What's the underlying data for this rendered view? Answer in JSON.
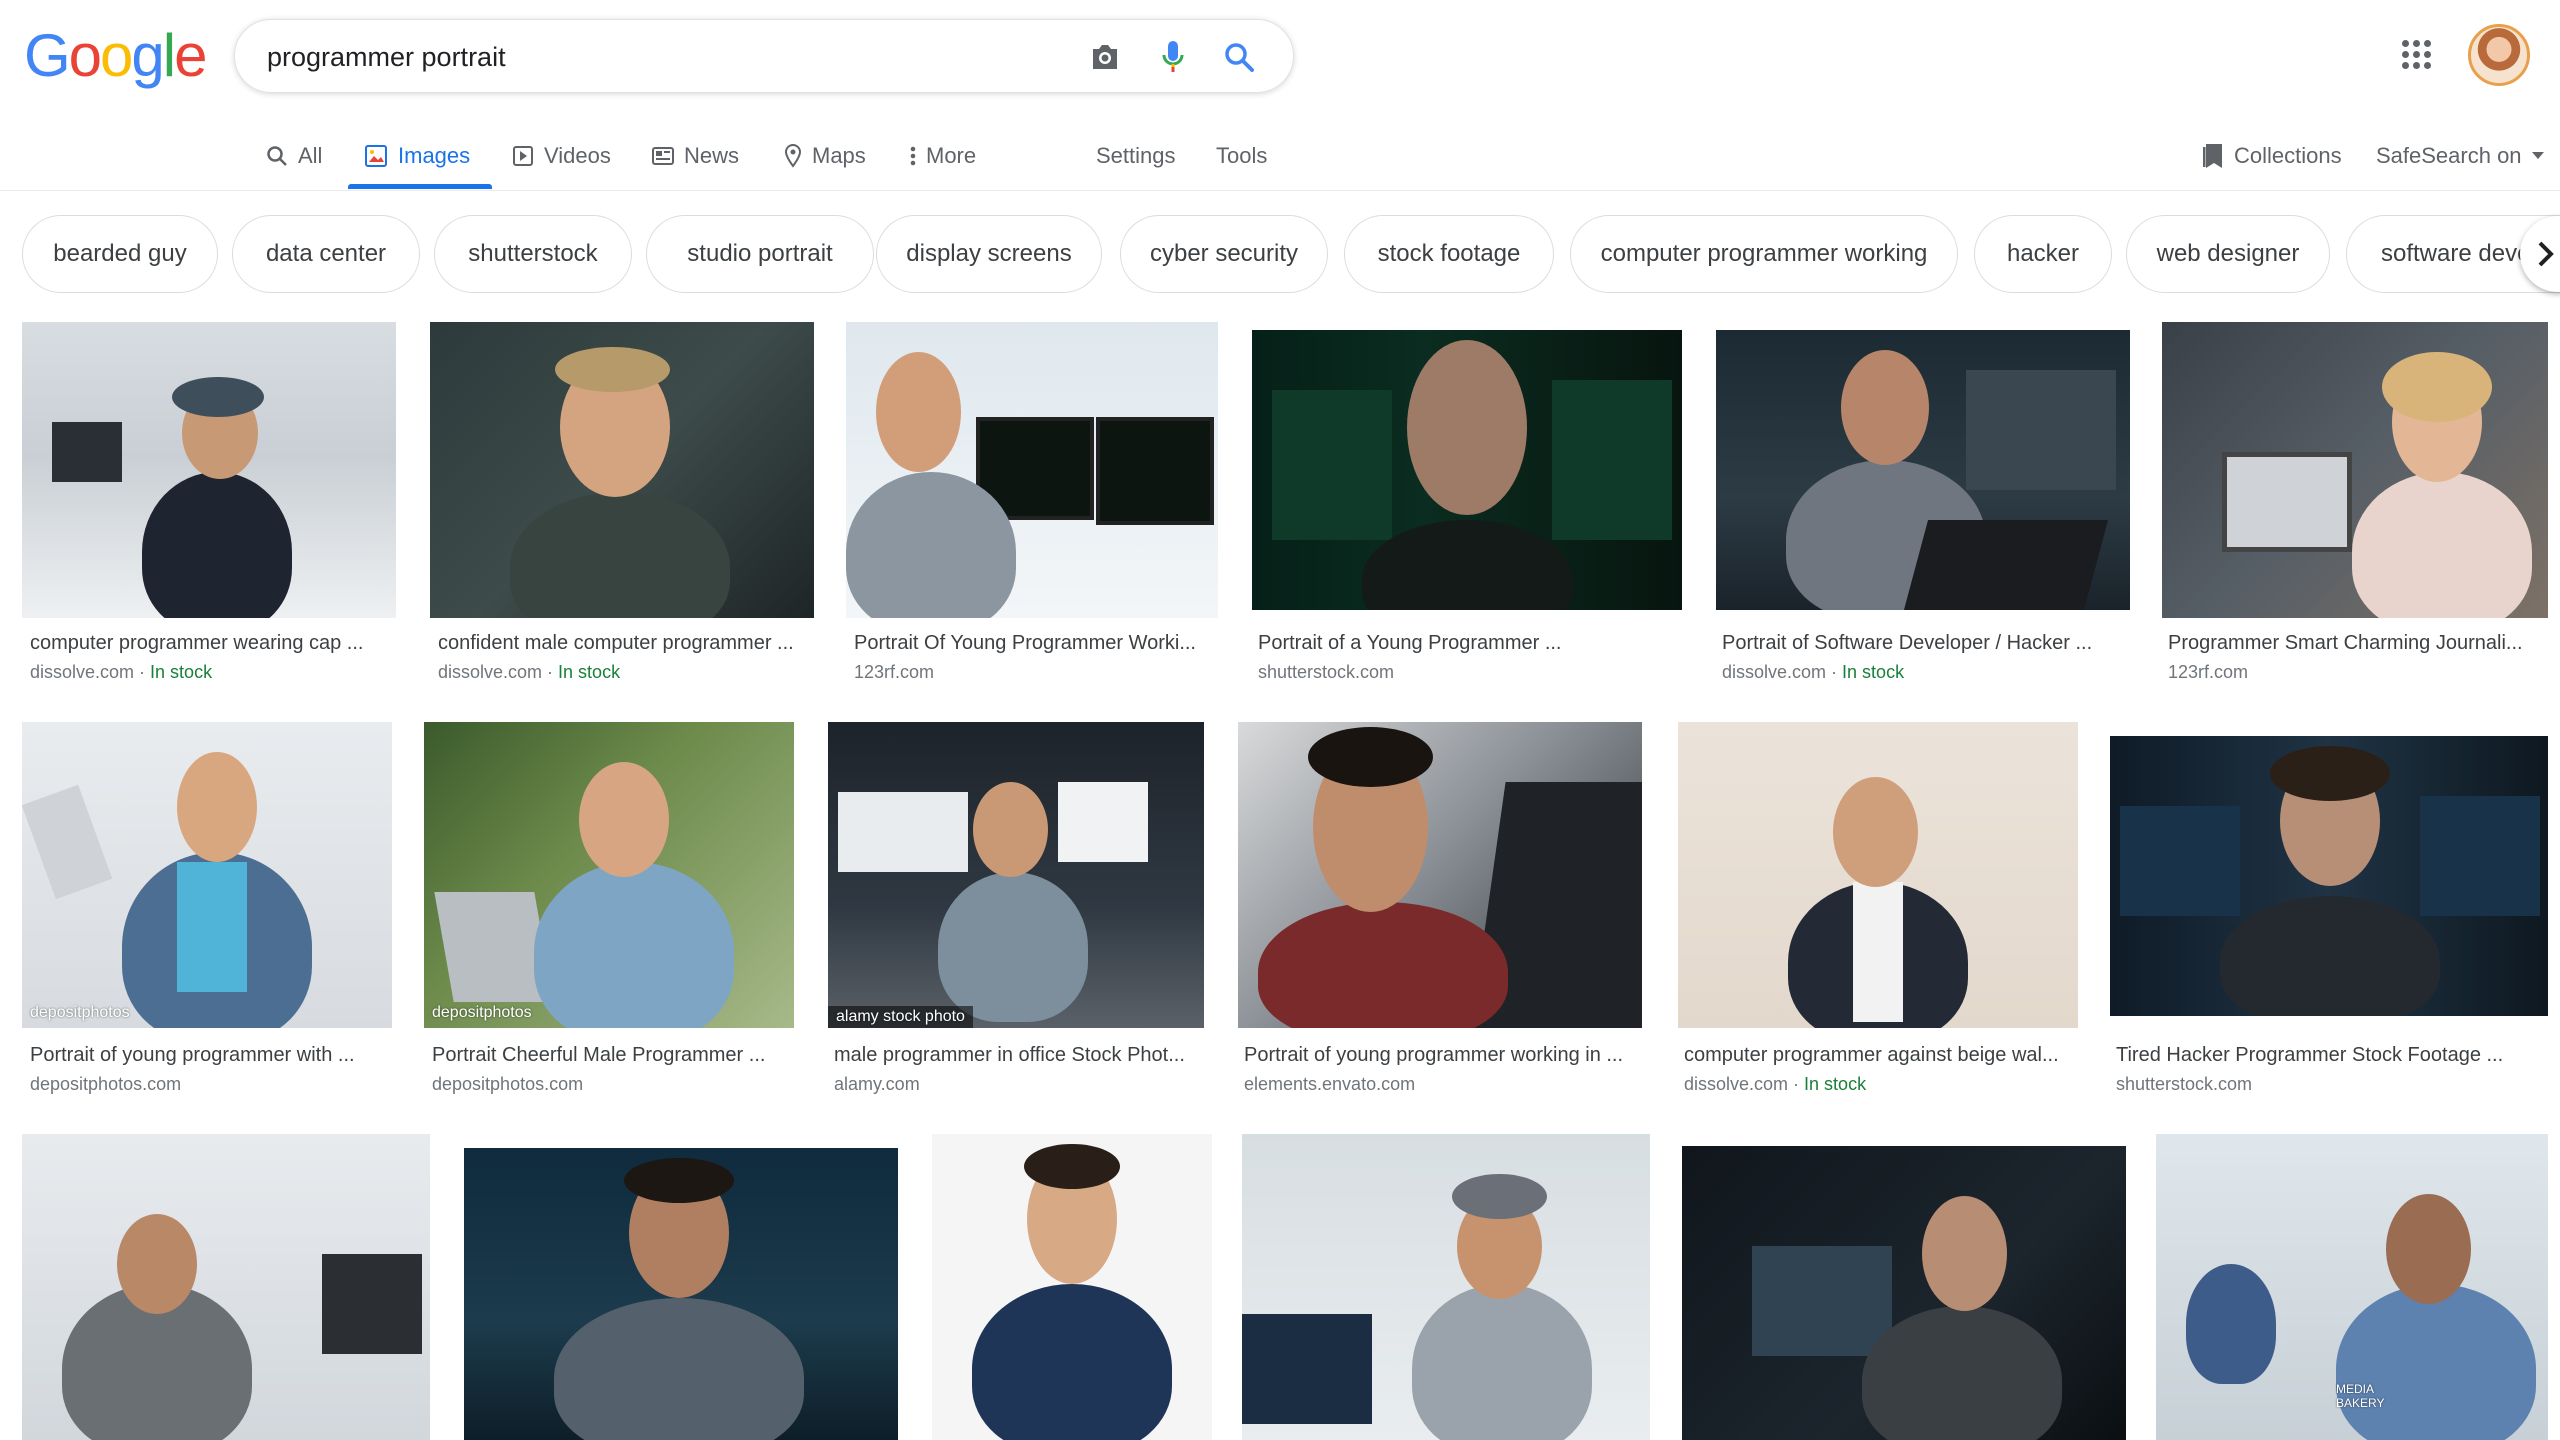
{
  "logo": {
    "letters": [
      "G",
      "o",
      "o",
      "g",
      "l",
      "e"
    ],
    "colors": [
      "#4285F4",
      "#EA4335",
      "#FBBC05",
      "#4285F4",
      "#34A853",
      "#EA4335"
    ]
  },
  "search": {
    "query": "programmer portrait"
  },
  "icons": {
    "camera": "camera-icon",
    "mic": "microphone-icon",
    "search": "search-icon",
    "apps": "apps-grid-icon"
  },
  "nav": {
    "tabs": [
      {
        "label": "All",
        "icon": "search-icon"
      },
      {
        "label": "Images",
        "icon": "image-icon",
        "active": true
      },
      {
        "label": "Videos",
        "icon": "video-icon"
      },
      {
        "label": "News",
        "icon": "news-icon"
      },
      {
        "label": "Maps",
        "icon": "map-pin-icon"
      },
      {
        "label": "More",
        "icon": "more-vert-icon"
      }
    ],
    "settings": "Settings",
    "tools": "Tools",
    "collections": "Collections",
    "safesearch": "SafeSearch on"
  },
  "chips": [
    "bearded guy",
    "data center",
    "shutterstock",
    "studio portrait",
    "display screens",
    "cyber security",
    "stock footage",
    "computer programmer working",
    "hacker",
    "web designer",
    "software deve"
  ],
  "accent": "#1a73e8",
  "stock_color": "#188038",
  "results": [
    {
      "caption": "computer programmer wearing cap ...",
      "source": "dissolve.com",
      "in_stock": "In stock"
    },
    {
      "caption": "confident male computer programmer ...",
      "source": "dissolve.com",
      "in_stock": "In stock"
    },
    {
      "caption": "Portrait Of Young Programmer Worki...",
      "source": "123rf.com"
    },
    {
      "caption": "Portrait of a Young Programmer ...",
      "source": "shutterstock.com"
    },
    {
      "caption": "Portrait of Software Developer / Hacker ...",
      "source": "dissolve.com",
      "in_stock": "In stock"
    },
    {
      "caption": "Programmer Smart Charming Journali...",
      "source": "123rf.com"
    },
    {
      "caption": "Portrait of young programmer with ...",
      "source": "depositphotos.com",
      "watermark": "depositphotos"
    },
    {
      "caption": "Portrait Cheerful Male Programmer ...",
      "source": "depositphotos.com",
      "watermark": "depositphotos"
    },
    {
      "caption": "male programmer in office Stock Phot...",
      "source": "alamy.com",
      "watermark": "alamy stock photo"
    },
    {
      "caption": "Portrait of young programmer working in ...",
      "source": "elements.envato.com"
    },
    {
      "caption": "computer programmer against beige wal...",
      "source": "dissolve.com",
      "in_stock": "In stock"
    },
    {
      "caption": "Tired Hacker Programmer Stock Footage ...",
      "source": "shutterstock.com"
    },
    {},
    {},
    {},
    {},
    {},
    {
      "watermark": "MEDIA BAKERY"
    }
  ]
}
